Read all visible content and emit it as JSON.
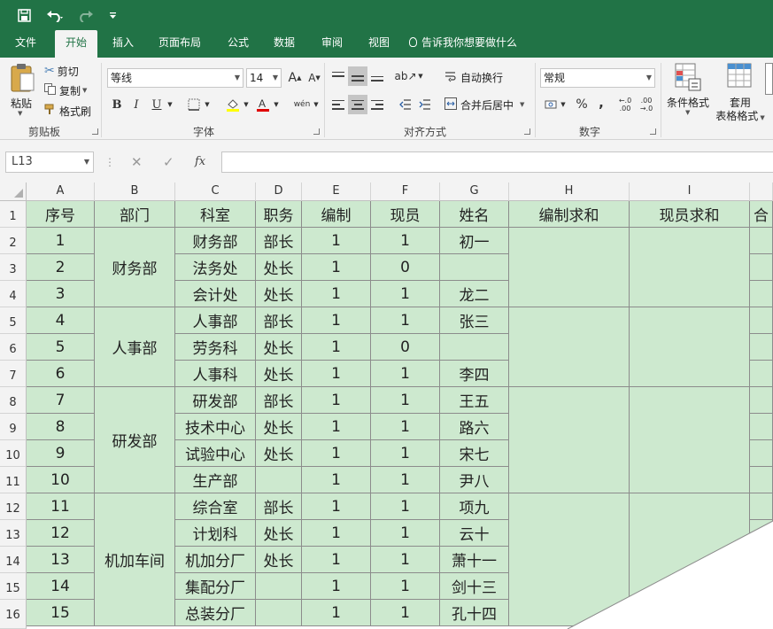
{
  "qat": {
    "save_icon": "save-icon",
    "undo_icon": "undo-icon",
    "redo_icon": "redo-icon",
    "customize_icon": "customize-qat-icon"
  },
  "tabs": [
    {
      "label": "文件"
    },
    {
      "label": "开始"
    },
    {
      "label": "插入"
    },
    {
      "label": "页面布局"
    },
    {
      "label": "公式"
    },
    {
      "label": "数据"
    },
    {
      "label": "审阅"
    },
    {
      "label": "视图"
    }
  ],
  "tell_me": "告诉我你想要做什么",
  "ribbon": {
    "clipboard": {
      "paste": "粘贴",
      "cut": "剪切",
      "copy": "复制",
      "format_painter": "格式刷",
      "label": "剪贴板"
    },
    "font": {
      "name": "等线",
      "size": "14",
      "grow": "A",
      "shrink": "A",
      "bold": "B",
      "italic": "I",
      "underline": "U",
      "phonetic": "wén",
      "label": "字体"
    },
    "alignment": {
      "wrap_text": "自动换行",
      "merge_center": "合并后居中",
      "label": "对齐方式"
    },
    "number": {
      "format": "常规",
      "percent": "%",
      "comma": ",",
      "inc_decimal": "←.0 .00",
      "dec_decimal": ".00 →.0",
      "label": "数字"
    },
    "styles": {
      "conditional": "条件格式",
      "table_format_1": "套用",
      "table_format_2": "表格格式"
    }
  },
  "formula_bar": {
    "name_box": "L13",
    "cancel": "✕",
    "enter": "✓",
    "fx": "fx",
    "formula": ""
  },
  "columns": [
    "A",
    "B",
    "C",
    "D",
    "E",
    "F",
    "G",
    "H",
    "I"
  ],
  "row_numbers": [
    "1",
    "2",
    "3",
    "4",
    "5",
    "6",
    "7",
    "8",
    "9",
    "10",
    "11",
    "12",
    "13",
    "14",
    "15",
    "16"
  ],
  "sheet": {
    "headers": [
      "序号",
      "部门",
      "科室",
      "职务",
      "编制",
      "现员",
      "姓名",
      "编制求和",
      "现员求和",
      "合"
    ],
    "departments": [
      "财务部",
      "人事部",
      "研发部",
      "机加车间"
    ],
    "rows": [
      [
        "1",
        "财务部",
        "部长",
        "1",
        "1",
        "初一"
      ],
      [
        "2",
        "法务处",
        "处长",
        "1",
        "0",
        ""
      ],
      [
        "3",
        "会计处",
        "处长",
        "1",
        "1",
        "龙二"
      ],
      [
        "4",
        "人事部",
        "部长",
        "1",
        "1",
        "张三"
      ],
      [
        "5",
        "劳务科",
        "处长",
        "1",
        "0",
        ""
      ],
      [
        "6",
        "人事科",
        "处长",
        "1",
        "1",
        "李四"
      ],
      [
        "7",
        "研发部",
        "部长",
        "1",
        "1",
        "王五"
      ],
      [
        "8",
        "技术中心",
        "处长",
        "1",
        "1",
        "路六"
      ],
      [
        "9",
        "试验中心",
        "处长",
        "1",
        "1",
        "宋七"
      ],
      [
        "10",
        "生产部",
        "",
        "1",
        "1",
        "尹八"
      ],
      [
        "11",
        "综合室",
        "部长",
        "1",
        "1",
        "项九"
      ],
      [
        "12",
        "计划科",
        "处长",
        "1",
        "1",
        "云十"
      ],
      [
        "13",
        "机加分厂",
        "处长",
        "1",
        "1",
        "萧十一"
      ],
      [
        "14",
        "集配分厂",
        "",
        "1",
        "1",
        "剑十三"
      ],
      [
        "15",
        "总装分厂",
        "",
        "1",
        "1",
        "孔十四"
      ]
    ]
  },
  "colors": {
    "brand": "#217346",
    "cell_fill": "#cde9cf",
    "ribbon_bg": "#f3f3f3"
  }
}
